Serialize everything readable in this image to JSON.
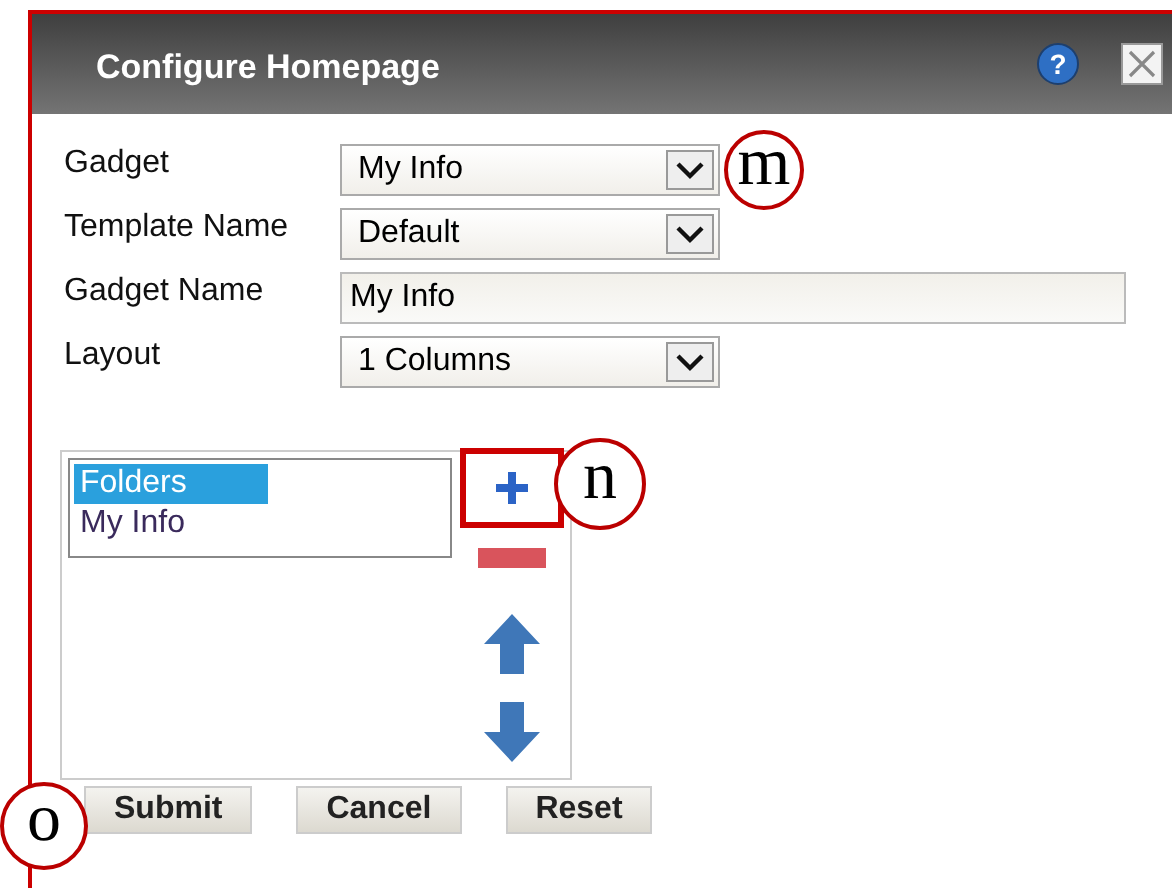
{
  "window": {
    "title": "Configure Homepage",
    "help_glyph": "?"
  },
  "fields": [
    {
      "kind": "select",
      "label": "Gadget",
      "value": "My Info",
      "callout": "m"
    },
    {
      "kind": "select",
      "label": "Template Name",
      "value": "Default"
    },
    {
      "kind": "text",
      "label": "Gadget Name",
      "value": "My Info"
    },
    {
      "kind": "select",
      "label": "Layout",
      "value": "1 Columns"
    }
  ],
  "list": {
    "items": [
      {
        "label": "Folders",
        "selected": true
      },
      {
        "label": "My Info",
        "selected": false
      }
    ],
    "add_callout": "n"
  },
  "buttons": [
    {
      "label": "Submit",
      "callout": "o"
    },
    {
      "label": "Cancel"
    },
    {
      "label": "Reset"
    }
  ]
}
